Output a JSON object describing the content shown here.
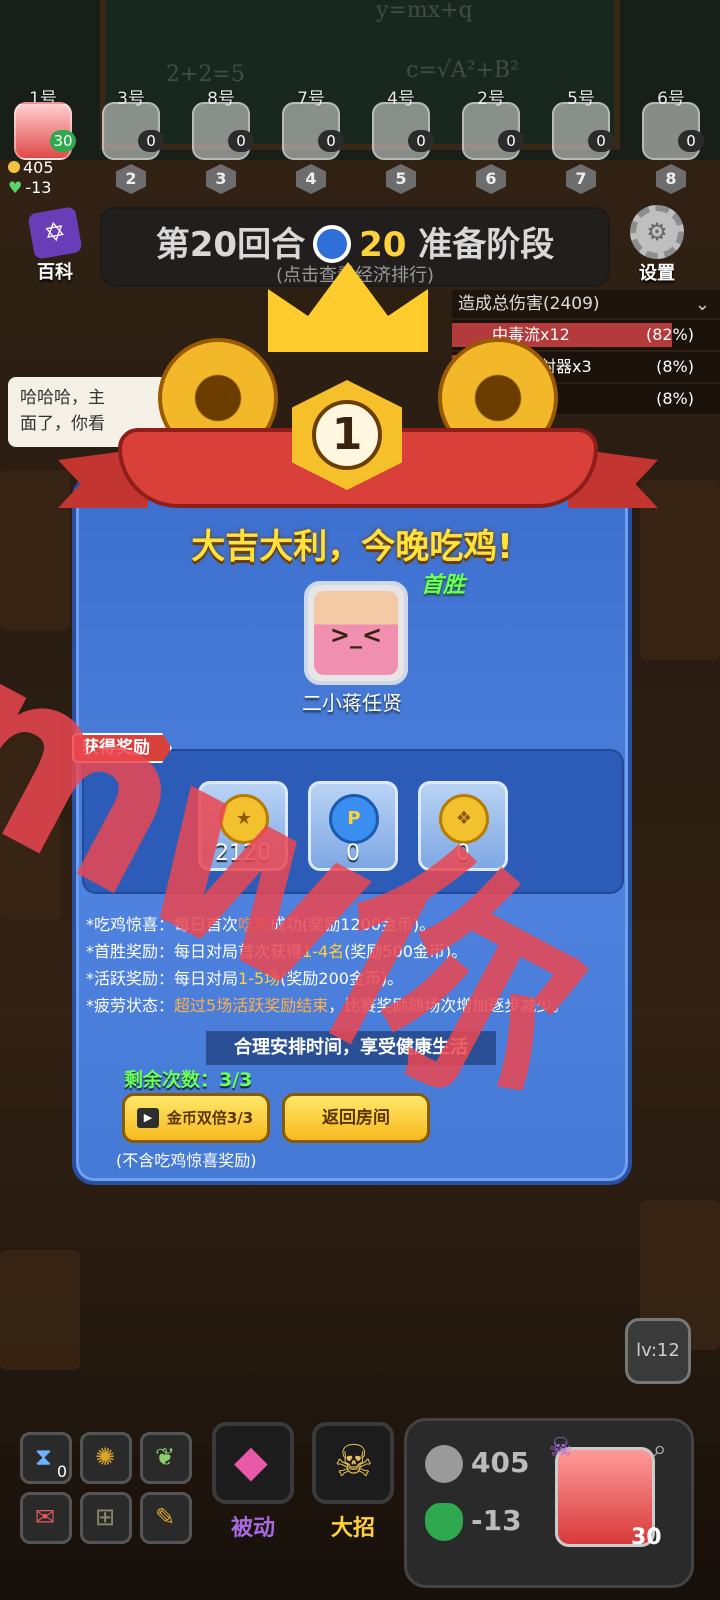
{
  "colors": {
    "accent_yellow": "#ffd23c",
    "dialog_blue": "#4479d6",
    "ribbon_red": "#d9403a",
    "green_text": "#6aff5a",
    "watermark_red": "#eb4650"
  },
  "chalkboard": {
    "formula_top": "y=mx+q",
    "formula_mid": "c=√A²+B²",
    "formula_left": "2+2=5"
  },
  "players": [
    {
      "num": "1号",
      "hearts": "30",
      "rank": "",
      "self": true
    },
    {
      "num": "3号",
      "hearts": "0",
      "rank": "2"
    },
    {
      "num": "8号",
      "hearts": "0",
      "rank": "3"
    },
    {
      "num": "7号",
      "hearts": "0",
      "rank": "4"
    },
    {
      "num": "4号",
      "hearts": "0",
      "rank": "5"
    },
    {
      "num": "2号",
      "hearts": "0",
      "rank": "6"
    },
    {
      "num": "5号",
      "hearts": "0",
      "rank": "7"
    },
    {
      "num": "6号",
      "hearts": "0",
      "rank": "8"
    }
  ],
  "self_stats": {
    "coins": "405",
    "hp_delta": "-13"
  },
  "header": {
    "encyclopedia_label": "百科",
    "round_label": "第20回合",
    "timer_value": "20",
    "phase_label": "准备阶段",
    "economy_hint": "(点击查看经济排行)",
    "settings_label": "设置",
    "damage_title": "造成总伤害(2409)",
    "damage_rows": [
      {
        "name": "中毒流x12",
        "pct": "(82%)",
        "fill": 0.82
      },
      {
        "name": "米花连射器x3",
        "pct": "(8%)",
        "fill": 0.08
      },
      {
        "name": "",
        "pct": "(8%)",
        "fill": 0.08
      }
    ]
  },
  "chat": {
    "line1": "哈哈哈，主",
    "line2": "面了，你看"
  },
  "dialog": {
    "rank": "1",
    "headline": "大吉大利，今晚吃鸡!",
    "first_win_tag": "首胜",
    "avatar_face": ">_<",
    "player_name": "二小蒋任贤",
    "reward_tab": "获得奖励",
    "rewards": [
      {
        "icon": "coin-icon",
        "value": "2120"
      },
      {
        "icon": "p-token-icon",
        "value": "0"
      },
      {
        "icon": "medal-icon",
        "value": "0"
      }
    ],
    "rules": [
      {
        "label": "*吃鸡惊喜：每日首次",
        "hl": "吃鸡",
        "rest": "成功(奖励1200金币)。"
      },
      {
        "label": "*首胜奖励：每日对局首次获得",
        "hl": "1-4名",
        "rest": "(奖励500金币)。"
      },
      {
        "label": "*活跃奖励：每日对局",
        "hl": "1-5场",
        "rest": "(奖励200金币)。"
      },
      {
        "label": "*疲劳状态：",
        "hl": "超过5场活跃奖励结束",
        "rest": "，比赛奖励随场次增加逐步减少。"
      }
    ],
    "tip": "合理安排时间，享受健康生活",
    "remaining": "剩余次数：3/3",
    "double_button": "金币双倍3/3",
    "back_button": "返回房间",
    "note": "(不含吃鸡惊喜奖励)"
  },
  "watermark_text": "mw你",
  "bottom": {
    "hourglass_count": "0",
    "passive_label": "被动",
    "ultimate_label": "大招",
    "coins": "405",
    "hp": "-13",
    "hearts": "30",
    "level": "lv:12"
  }
}
